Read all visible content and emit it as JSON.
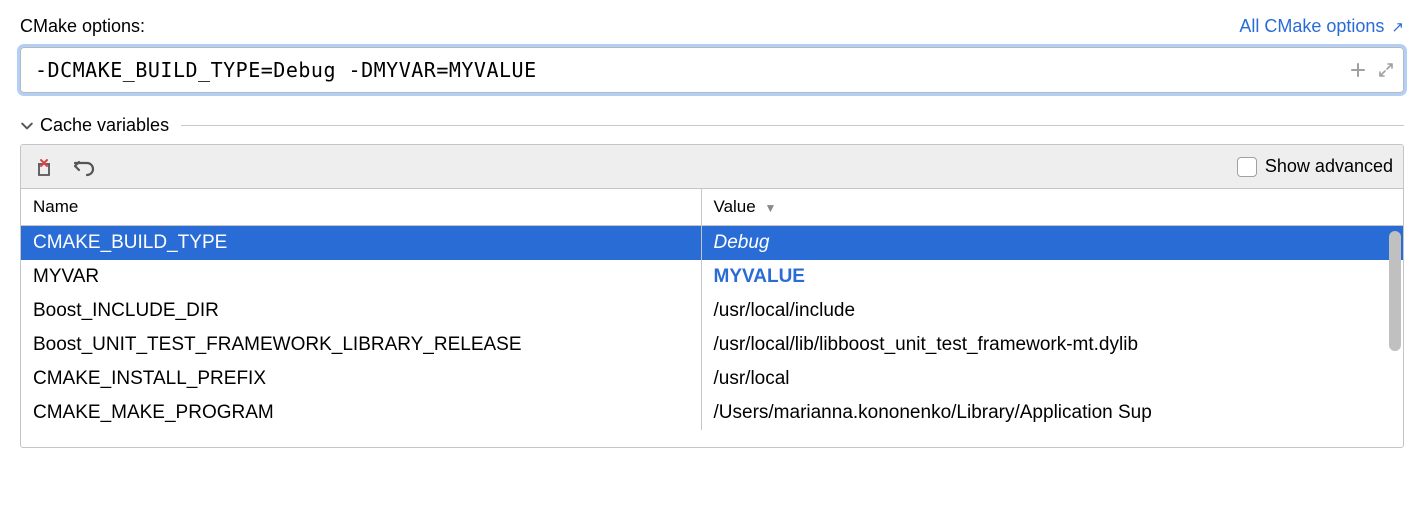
{
  "header": {
    "label": "CMake options:",
    "link": "All CMake options",
    "link_icon": "↗"
  },
  "options": {
    "value": "-DCMAKE_BUILD_TYPE=Debug -DMYVAR=MYVALUE"
  },
  "section": {
    "title": "Cache variables"
  },
  "toolbar": {
    "show_advanced_label": "Show advanced"
  },
  "table": {
    "col_name": "Name",
    "col_value": "Value",
    "rows": [
      {
        "name": "CMAKE_BUILD_TYPE",
        "value": "Debug"
      },
      {
        "name": "MYVAR",
        "value": "MYVALUE"
      },
      {
        "name": "Boost_INCLUDE_DIR",
        "value": "/usr/local/include"
      },
      {
        "name": "Boost_UNIT_TEST_FRAMEWORK_LIBRARY_RELEASE",
        "value": "/usr/local/lib/libboost_unit_test_framework-mt.dylib"
      },
      {
        "name": "CMAKE_INSTALL_PREFIX",
        "value": "/usr/local"
      },
      {
        "name": "CMAKE_MAKE_PROGRAM",
        "value": "/Users/marianna.kononenko/Library/Application Sup"
      }
    ]
  }
}
